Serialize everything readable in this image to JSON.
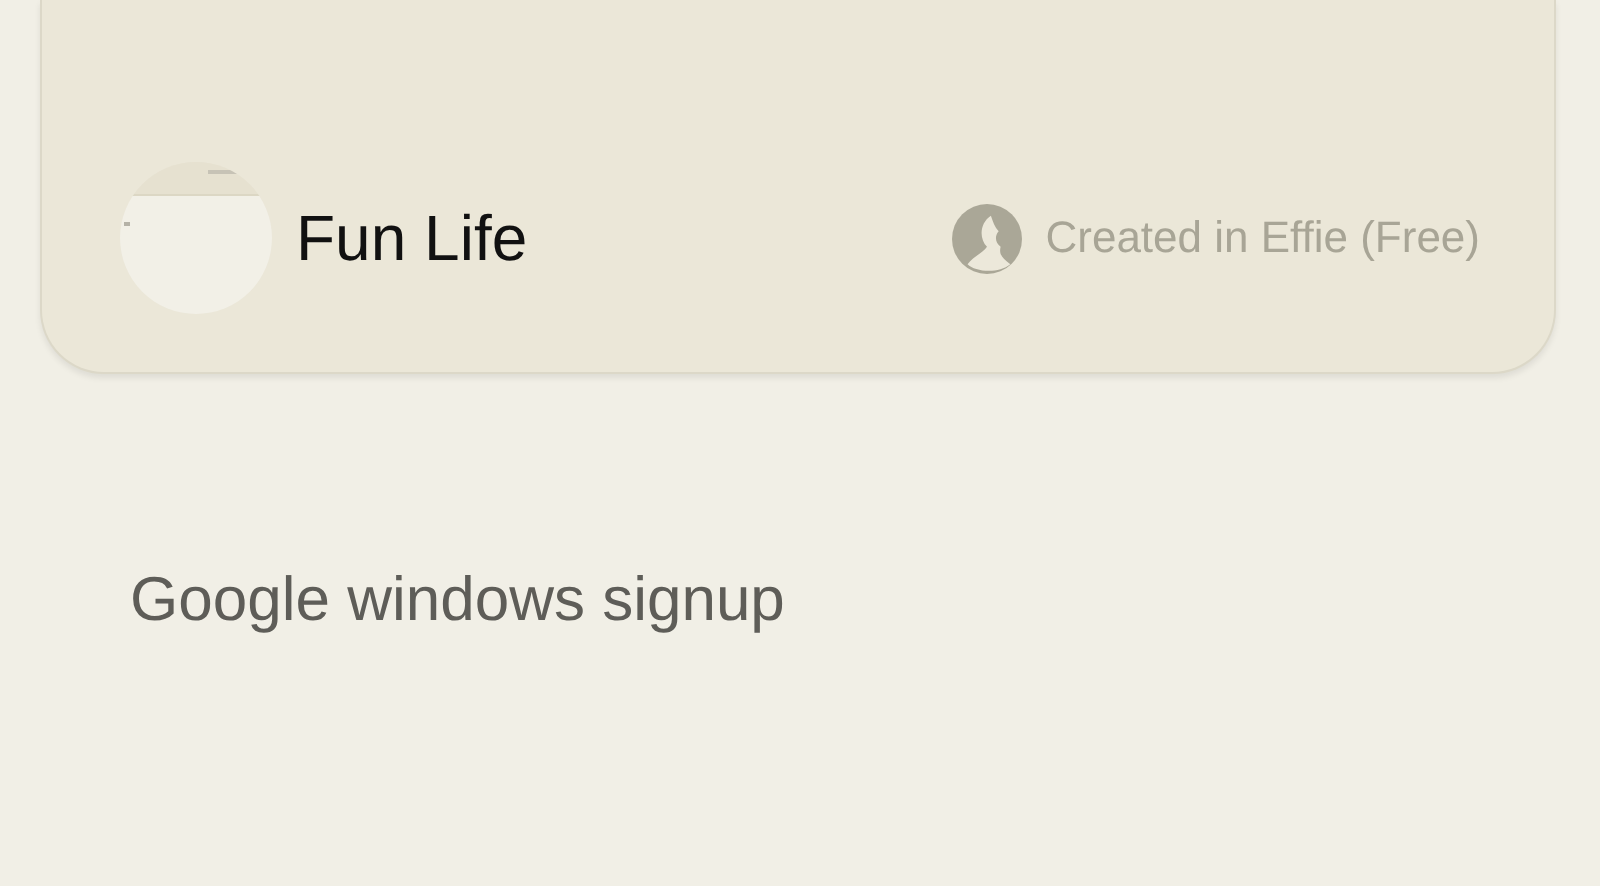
{
  "card": {
    "title": "Fun Life",
    "credit": "Created in Effie (Free)"
  },
  "heading": "Google windows signup"
}
